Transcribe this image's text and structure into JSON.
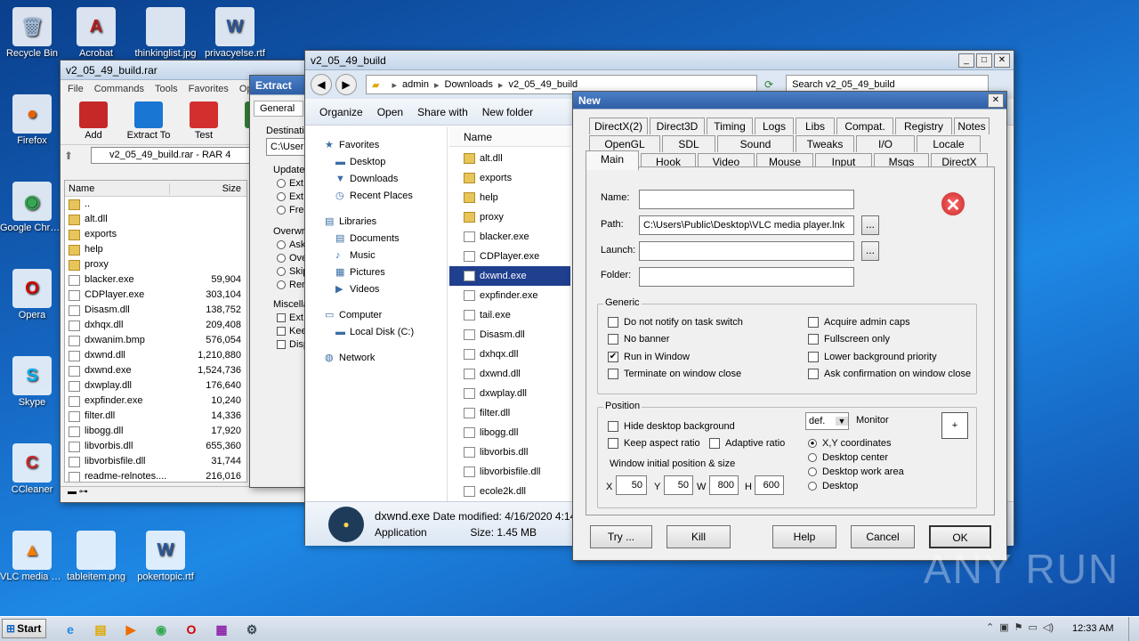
{
  "desktop": {
    "icons": [
      {
        "label": "Recycle Bin",
        "glyph": "🗑",
        "color": "#9fb8d6"
      },
      {
        "label": "Acrobat",
        "glyph": "A",
        "color": "#b71c1c"
      },
      {
        "label": "thinkinglist.jpg",
        "glyph": "",
        "color": "#000"
      },
      {
        "label": "privacyelse.rtf",
        "glyph": "W",
        "color": "#2b579a"
      },
      {
        "label": "Firefox",
        "glyph": "●",
        "color": "#e66000"
      },
      {
        "label": "Google Chrome",
        "glyph": "◉",
        "color": "#34a853"
      },
      {
        "label": "Opera",
        "glyph": "O",
        "color": "#d50000"
      },
      {
        "label": "Skype",
        "glyph": "S",
        "color": "#00aff0"
      },
      {
        "label": "CCleaner",
        "glyph": "C",
        "color": "#c62828"
      },
      {
        "label": "VLC media player",
        "glyph": "▲",
        "color": "#f57c00"
      },
      {
        "label": "tableitem.png",
        "glyph": "",
        "color": "#1976d2"
      },
      {
        "label": "pokertopic.rtf",
        "glyph": "W",
        "color": "#2b579a"
      }
    ]
  },
  "winrar": {
    "title": "v2_05_49_build.rar",
    "menu": [
      "File",
      "Commands",
      "Tools",
      "Favorites",
      "Opti"
    ],
    "tools": [
      "Add",
      "Extract To",
      "Test",
      "Vie"
    ],
    "path": "v2_05_49_build.rar - RAR 4",
    "col_name": "Name",
    "col_size": "Size",
    "files": [
      {
        "name": "..",
        "size": "",
        "folder": true
      },
      {
        "name": "alt.dll",
        "size": "",
        "folder": true
      },
      {
        "name": "exports",
        "size": "",
        "folder": true
      },
      {
        "name": "help",
        "size": "",
        "folder": true
      },
      {
        "name": "proxy",
        "size": "",
        "folder": true
      },
      {
        "name": "blacker.exe",
        "size": "59,904"
      },
      {
        "name": "CDPlayer.exe",
        "size": "303,104"
      },
      {
        "name": "Disasm.dll",
        "size": "138,752"
      },
      {
        "name": "dxhqx.dll",
        "size": "209,408"
      },
      {
        "name": "dxwanim.bmp",
        "size": "576,054"
      },
      {
        "name": "dxwnd.dll",
        "size": "1,210,880"
      },
      {
        "name": "dxwnd.exe",
        "size": "1,524,736"
      },
      {
        "name": "dxwplay.dll",
        "size": "176,640"
      },
      {
        "name": "expfinder.exe",
        "size": "10,240"
      },
      {
        "name": "filter.dll",
        "size": "14,336"
      },
      {
        "name": "libogg.dll",
        "size": "17,920"
      },
      {
        "name": "libvorbis.dll",
        "size": "655,360"
      },
      {
        "name": "libvorbisfile.dll",
        "size": "31,744"
      },
      {
        "name": "readme-relnotes....",
        "size": "216,016"
      }
    ]
  },
  "extract": {
    "title": "Extract",
    "tab": "General",
    "dest": "Destinati",
    "dest_val": "C:\\User",
    "update": "Update",
    "update_opts": [
      "Ext",
      "Ext",
      "Fre"
    ],
    "overwrite": "Overwri",
    "overwrite_opts": [
      "Ask",
      "Ove",
      "Skip",
      "Ren"
    ],
    "misc": "Miscella",
    "misc_opts": [
      "Ext",
      "Kee",
      "Disp"
    ]
  },
  "explorer": {
    "title": "v2_05_49_build",
    "crumbs": [
      "admin",
      "Downloads",
      "v2_05_49_build"
    ],
    "search": "Search v2_05_49_build",
    "toolbar": [
      "Organize",
      "Open",
      "Share with",
      "New folder"
    ],
    "nav": [
      {
        "label": "Favorites",
        "indent": 0,
        "glyph": "★"
      },
      {
        "label": "Desktop",
        "indent": 1,
        "glyph": "▬"
      },
      {
        "label": "Downloads",
        "indent": 1,
        "glyph": "▼"
      },
      {
        "label": "Recent Places",
        "indent": 1,
        "glyph": "◷"
      },
      {
        "label": "Libraries",
        "indent": 0,
        "glyph": "▤"
      },
      {
        "label": "Documents",
        "indent": 1,
        "glyph": "▤"
      },
      {
        "label": "Music",
        "indent": 1,
        "glyph": "♪"
      },
      {
        "label": "Pictures",
        "indent": 1,
        "glyph": "▦"
      },
      {
        "label": "Videos",
        "indent": 1,
        "glyph": "▶"
      },
      {
        "label": "Computer",
        "indent": 0,
        "glyph": "▭"
      },
      {
        "label": "Local Disk (C:)",
        "indent": 1,
        "glyph": "▬"
      },
      {
        "label": "Network",
        "indent": 0,
        "glyph": "◍"
      }
    ],
    "col_name": "Name",
    "files": [
      {
        "name": "alt.dll",
        "folder": true
      },
      {
        "name": "exports",
        "folder": true
      },
      {
        "name": "help",
        "folder": true
      },
      {
        "name": "proxy",
        "folder": true
      },
      {
        "name": "blacker.exe"
      },
      {
        "name": "CDPlayer.exe"
      },
      {
        "name": "dxwnd.exe",
        "selected": true
      },
      {
        "name": "expfinder.exe"
      },
      {
        "name": "tail.exe"
      },
      {
        "name": "Disasm.dll"
      },
      {
        "name": "dxhqx.dll"
      },
      {
        "name": "dxwnd.dll"
      },
      {
        "name": "dxwplay.dll"
      },
      {
        "name": "filter.dll"
      },
      {
        "name": "libogg.dll"
      },
      {
        "name": "libvorbis.dll"
      },
      {
        "name": "libvorbisfile.dll"
      },
      {
        "name": "ecole2k.dll"
      }
    ],
    "details": {
      "name": "dxwnd.exe",
      "type": "Application",
      "modified": "Date modified: 4/16/2020 4:14",
      "size": "Size: 1.45 MB"
    }
  },
  "dialog": {
    "title": "New",
    "tabs_row1": [
      "DirectX(2)",
      "Direct3D",
      "Timing",
      "Logs",
      "Libs",
      "Compat.",
      "Registry",
      "Notes"
    ],
    "tabs_row2": [
      "OpenGL",
      "SDL",
      "Sound",
      "Tweaks",
      "I/O",
      "Locale"
    ],
    "tabs_row3": [
      "Main",
      "Hook",
      "Video",
      "Mouse",
      "Input",
      "Msgs",
      "DirectX"
    ],
    "name_label": "Name:",
    "path_label": "Path:",
    "path_value": "C:\\Users\\Public\\Desktop\\VLC media player.lnk",
    "launch_label": "Launch:",
    "folder_label": "Folder:",
    "browse": "...",
    "generic": "Generic",
    "generic_left": [
      {
        "label": "Do not notify on task switch",
        "checked": false
      },
      {
        "label": "No banner",
        "checked": false
      },
      {
        "label": "Run in Window",
        "checked": true
      },
      {
        "label": "Terminate on window close",
        "checked": false
      }
    ],
    "generic_right": [
      {
        "label": "Acquire admin caps",
        "checked": false
      },
      {
        "label": "Fullscreen only",
        "checked": false
      },
      {
        "label": "Lower background priority",
        "checked": false
      },
      {
        "label": "Ask confirmation on window close",
        "checked": false
      }
    ],
    "position": "Position",
    "hide_bg": "Hide desktop background",
    "keep_aspect": "Keep aspect ratio",
    "adaptive": "Adaptive ratio",
    "monitor_val": "def.",
    "monitor": "Monitor",
    "radios": [
      {
        "label": "X,Y coordinates",
        "checked": true
      },
      {
        "label": "Desktop center",
        "checked": false
      },
      {
        "label": "Desktop work area",
        "checked": false
      },
      {
        "label": "Desktop",
        "checked": false
      }
    ],
    "initpos": "Window initial position & size",
    "x_l": "X",
    "x": "50",
    "y_l": "Y",
    "y": "50",
    "w_l": "W",
    "w": "800",
    "h_l": "H",
    "h": "600",
    "buttons": [
      "Try ...",
      "Kill",
      "Help",
      "Cancel",
      "OK"
    ]
  },
  "taskbar": {
    "start": "Start",
    "clock": "12:33 AM"
  },
  "watermark": "ANY RUN"
}
